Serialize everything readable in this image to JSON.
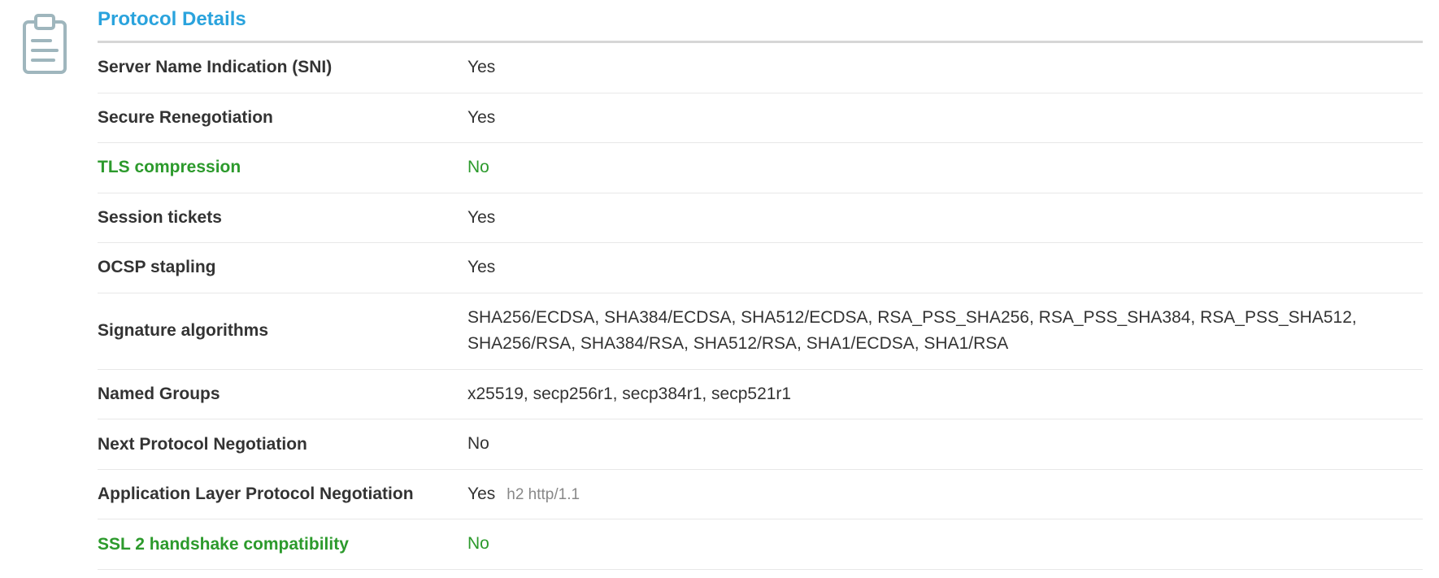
{
  "section_title": "Protocol Details",
  "rows": [
    {
      "label": "Server Name Indication (SNI)",
      "value": "Yes",
      "label_green": false,
      "value_green": false,
      "extra": ""
    },
    {
      "label": "Secure Renegotiation",
      "value": "Yes",
      "label_green": false,
      "value_green": false,
      "extra": ""
    },
    {
      "label": "TLS compression",
      "value": "No",
      "label_green": true,
      "value_green": true,
      "extra": ""
    },
    {
      "label": "Session tickets",
      "value": "Yes",
      "label_green": false,
      "value_green": false,
      "extra": ""
    },
    {
      "label": "OCSP stapling",
      "value": "Yes",
      "label_green": false,
      "value_green": false,
      "extra": ""
    },
    {
      "label": "Signature algorithms",
      "value": "SHA256/ECDSA, SHA384/ECDSA, SHA512/ECDSA, RSA_PSS_SHA256, RSA_PSS_SHA384, RSA_PSS_SHA512, SHA256/RSA, SHA384/RSA, SHA512/RSA, SHA1/ECDSA, SHA1/RSA",
      "label_green": false,
      "value_green": false,
      "extra": ""
    },
    {
      "label": "Named Groups",
      "value": "x25519, secp256r1, secp384r1, secp521r1",
      "label_green": false,
      "value_green": false,
      "extra": ""
    },
    {
      "label": "Next Protocol Negotiation",
      "value": "No",
      "label_green": false,
      "value_green": false,
      "extra": ""
    },
    {
      "label": "Application Layer Protocol Negotiation",
      "value": "Yes",
      "label_green": false,
      "value_green": false,
      "extra": "h2 http/1.1"
    },
    {
      "label": "SSL 2 handshake compatibility",
      "value": "No",
      "label_green": true,
      "value_green": true,
      "extra": ""
    }
  ]
}
